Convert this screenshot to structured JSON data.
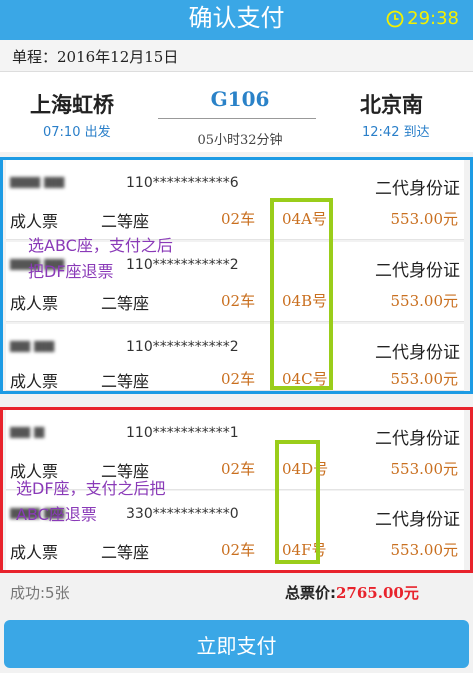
{
  "header": {
    "title": "确认支付",
    "timer": "29:38",
    "timer_icon": "clock-icon",
    "accent_color": "#3aa7e6",
    "timer_color": "#f3f000"
  },
  "trip": {
    "label": "单程：2016年12月15日",
    "from_station": "上海虹桥",
    "from_time": "07:10 出发",
    "train_no": "G106",
    "duration": "05小时32分钟",
    "to_station": "北京南",
    "to_time": "12:42 到达"
  },
  "tickets": [
    {
      "name": "",
      "id": "110***********6",
      "id_type": "二代身份证",
      "ticket_type": "成人票",
      "seat_class": "二等座",
      "car": "02车",
      "seat": "04A号",
      "price": "553.00元"
    },
    {
      "name": "",
      "id": "110***********2",
      "id_type": "二代身份证",
      "ticket_type": "成人票",
      "seat_class": "二等座",
      "car": "02车",
      "seat": "04B号",
      "price": "553.00元"
    },
    {
      "name": "",
      "id": "110***********2",
      "id_type": "二代身份证",
      "ticket_type": "成人票",
      "seat_class": "二等座",
      "car": "02车",
      "seat": "04C号",
      "price": "553.00元"
    },
    {
      "name": "",
      "id": "110***********1",
      "id_type": "二代身份证",
      "ticket_type": "成人票",
      "seat_class": "二等座",
      "car": "02车",
      "seat": "04D号",
      "price": "553.00元"
    },
    {
      "name": "",
      "id": "330***********0",
      "id_type": "二代身份证",
      "ticket_type": "成人票",
      "seat_class": "二等座",
      "car": "02车",
      "seat": "04F号",
      "price": "553.00元"
    }
  ],
  "annotations": {
    "blue_note": "选ABC座，支付之后\n把DF座退票",
    "red_note": "选DF座，支付之后把\nABC座退票",
    "blue_color": "#1d9be4",
    "red_color": "#e8232c",
    "highlight_color": "#9acd1a",
    "note_color": "#8a3ab8"
  },
  "summary": {
    "success": "成功:5张",
    "total_label": "总票价:",
    "total_value": "2765.00元"
  },
  "pay_button": "立即支付"
}
